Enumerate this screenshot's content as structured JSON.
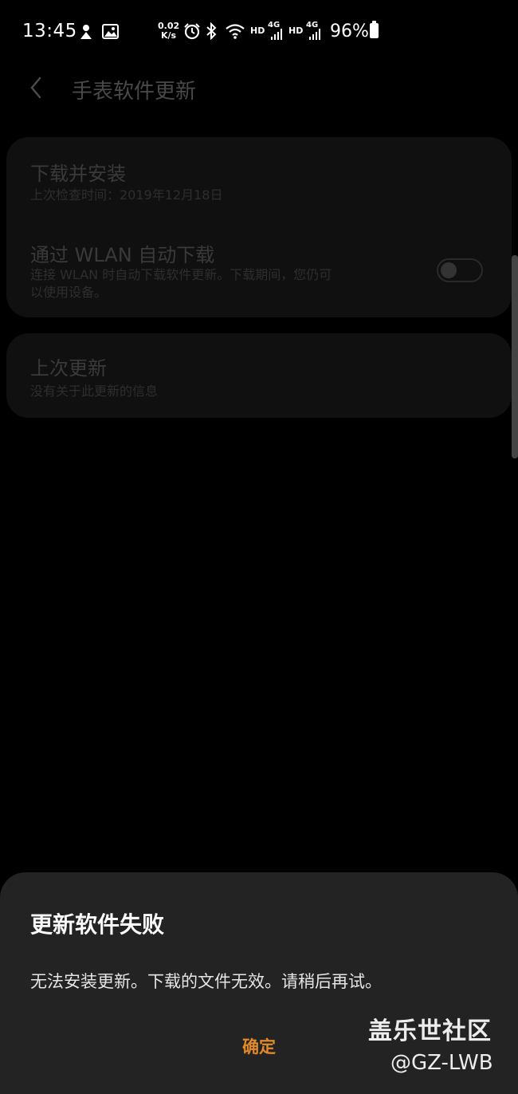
{
  "status_bar": {
    "time": "13:45",
    "net_speed_value": "0.02",
    "net_speed_unit": "K/s",
    "net_label_1": "HD",
    "net_gen_1": "4G",
    "net_label_2": "HD",
    "net_gen_2": "4G",
    "battery": "96%",
    "icons": [
      "weather-icon",
      "image-icon",
      "alarm-icon",
      "bluetooth-icon",
      "wifi-icon",
      "signal-icon",
      "signal-icon",
      "battery-icon"
    ]
  },
  "header": {
    "title": "手表软件更新",
    "back_icon": "chevron-left-icon"
  },
  "settings": {
    "download": {
      "title": "下载并安装",
      "subtitle": "上次检查时间：2019年12月18日"
    },
    "auto_download": {
      "title": "通过 WLAN 自动下载",
      "subtitle_line1": "连接 WLAN 时自动下载软件更新。下载期间，您仍可",
      "subtitle_line2": "以使用设备。",
      "toggle_on": false
    },
    "last_update": {
      "title": "上次更新",
      "subtitle": "没有关于此更新的信息"
    }
  },
  "dialog": {
    "title": "更新软件失败",
    "message": "无法安装更新。下载的文件无效。请稍后再试。",
    "confirm_label": "确定",
    "accent_color": "#e08a2c"
  },
  "watermark": {
    "line1": "盖乐世社区",
    "line2": "@GZ-LWB"
  }
}
